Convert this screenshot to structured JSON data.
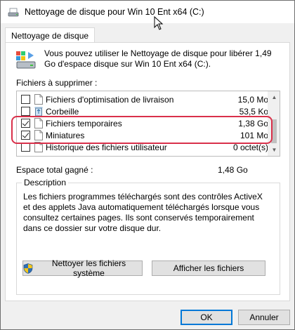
{
  "window": {
    "title": "Nettoyage de disque pour Win 10 Ent x64 (C:)"
  },
  "tab": {
    "label": "Nettoyage de disque"
  },
  "intro": {
    "text": "Vous pouvez utiliser le Nettoyage de disque pour libérer 1,49 Go d'espace disque sur Win 10 Ent x64 (C:)."
  },
  "files": {
    "label": "Fichiers à supprimer :",
    "items": [
      {
        "name": "Fichiers d'optimisation de livraison",
        "size": "15,0 Mo",
        "checked": false,
        "icon": "file-icon"
      },
      {
        "name": "Corbeille",
        "size": "53,5 Ko",
        "checked": false,
        "icon": "recycle-bin-icon"
      },
      {
        "name": "Fichiers temporaires",
        "size": "1,38 Go",
        "checked": true,
        "icon": "file-icon"
      },
      {
        "name": "Miniatures",
        "size": "101 Mo",
        "checked": true,
        "icon": "file-icon"
      },
      {
        "name": "Historique des fichiers utilisateur",
        "size": "0 octet(s)",
        "checked": false,
        "icon": "file-icon"
      }
    ]
  },
  "total": {
    "label": "Espace total gagné :",
    "value": "1,48 Go"
  },
  "description": {
    "title": "Description",
    "text": "Les fichiers programmes téléchargés sont des contrôles ActiveX et des applets Java automatiquement téléchargés lorsque vous consultez certaines pages. Ils sont conservés temporairement dans ce dossier sur votre disque dur."
  },
  "buttons": {
    "clean_system": "Nettoyer les fichiers système",
    "show_files": "Afficher les fichiers",
    "ok": "OK",
    "cancel": "Annuler"
  },
  "colors": {
    "highlight": "#d9304a",
    "accent": "#0078d7"
  }
}
